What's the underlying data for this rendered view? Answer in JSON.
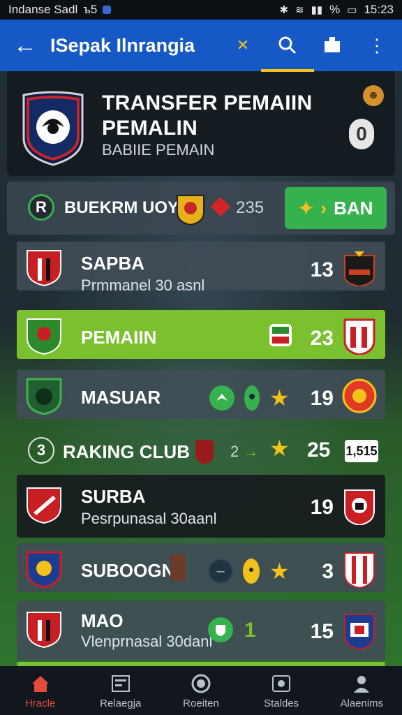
{
  "status_bar": {
    "left_text": "Indanse Sadl",
    "left_extra": "ъ5",
    "battery_text": "%",
    "time": "15:23"
  },
  "app_bar": {
    "title": "ISepak Ilnrangia",
    "back_icon": "arrow-left-icon",
    "actions": [
      "tick-icon",
      "search-icon",
      "bookmark-icon",
      "more-icon"
    ]
  },
  "header": {
    "title_line1": "TRANSFER PEMAIIN",
    "title_line2": "PEMALIN",
    "subtitle": "BABIIE PEMAIN",
    "badge": "0"
  },
  "filter": {
    "round": "R",
    "label": "BUEKRM UOY",
    "count": "235",
    "button_label": "BAN"
  },
  "rows": [
    {
      "name": "SAPBA",
      "sub": "Prmmanel 30 asnl",
      "num": "13",
      "style": "dark"
    },
    {
      "name": "PEMAIIN",
      "sub": "",
      "num": "23",
      "style": "green"
    },
    {
      "name": "MASUAR",
      "sub": "",
      "num": "19",
      "style": "dark"
    }
  ],
  "section": {
    "number": "3",
    "title": "RAKING CLUB",
    "mark": "2",
    "num": "25",
    "tag": "1,515"
  },
  "rows2": [
    {
      "name": "SURBA",
      "sub": "Pesrpunasal 30aanl",
      "num": "19",
      "style": "black"
    },
    {
      "name": "SUBOOGN",
      "sub": "",
      "num": "3",
      "style": "dark"
    },
    {
      "name": "MAO",
      "sub": "Vlenprnasal 30danl",
      "mid_num": "1",
      "num": "15",
      "style": "dark"
    }
  ],
  "nav": [
    {
      "label": "Hracle",
      "icon": "home-icon",
      "active": true
    },
    {
      "label": "Relaegja",
      "icon": "list-icon",
      "active": false
    },
    {
      "label": "Roeiten",
      "icon": "ball-icon",
      "active": false
    },
    {
      "label": "Staldes",
      "icon": "stats-icon",
      "active": false
    },
    {
      "label": "Alaenims",
      "icon": "profile-icon",
      "active": false
    }
  ],
  "colors": {
    "app_bar": "#1558c6",
    "accent_green": "#35b24e",
    "highlight_green": "#7bc02f",
    "star": "#f2c21b",
    "active_tab": "#e24a3a"
  }
}
